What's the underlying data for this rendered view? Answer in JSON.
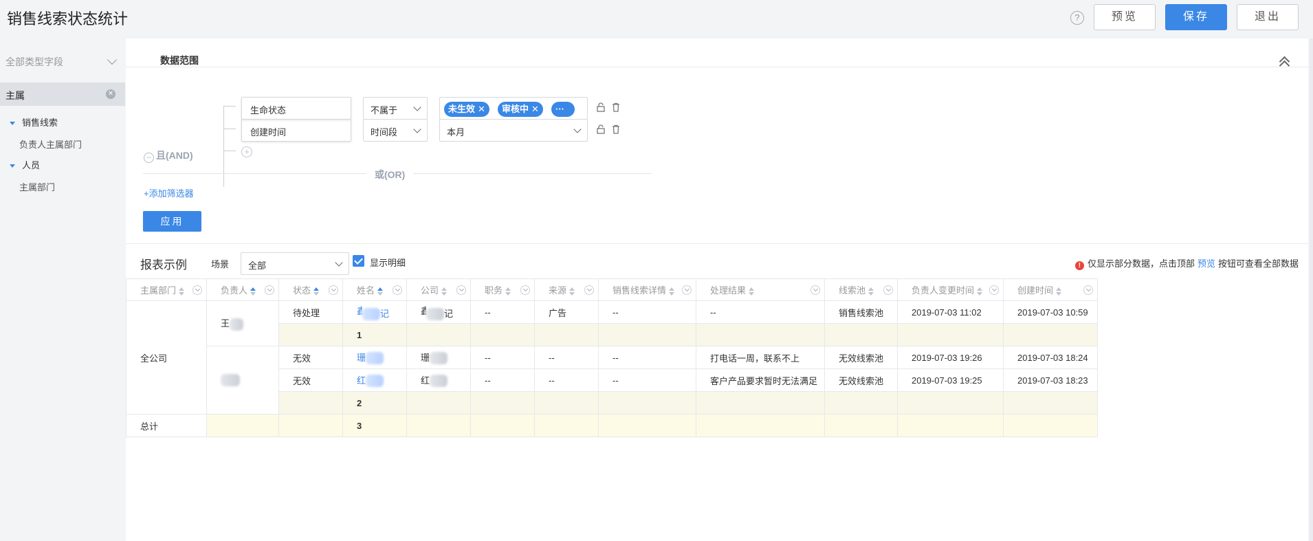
{
  "header": {
    "title": "销售线索状态统计",
    "help": "?",
    "preview_label": "预览",
    "save_label": "保存",
    "exit_label": "退出"
  },
  "sidebar": {
    "type_select": "全部类型字段",
    "active_item": "主属",
    "groups": [
      {
        "label": "销售线索",
        "items": [
          "负责人主属部门"
        ]
      },
      {
        "label": "人员",
        "items": [
          "主属部门"
        ]
      }
    ]
  },
  "filter": {
    "section_title": "数据范围",
    "and_label": "且(AND)",
    "conditions": [
      {
        "field": "生命状态",
        "operator": "不属于",
        "tags": [
          "未生效",
          "审核中",
          "···"
        ]
      },
      {
        "field": "创建时间",
        "operator": "时间段",
        "value": "本月"
      }
    ],
    "or_label": "或(OR)",
    "add_filter": "+添加筛选器",
    "apply_label": "应用"
  },
  "report": {
    "title": "报表示例",
    "scene_label": "场景",
    "scene_value": "全部",
    "show_detail_label": "显示明细",
    "show_detail_checked": true,
    "notice_prefix": "仅显示部分数据，点击顶部",
    "notice_link": "预览",
    "notice_suffix": "按钮可查看全部数据",
    "columns": [
      "主属部门",
      "负责人",
      "状态",
      "姓名",
      "公司",
      "职务",
      "来源",
      "销售线索详情",
      "处理结果",
      "线索池",
      "负责人变更时间",
      "创建时间"
    ],
    "dept": "全公司",
    "owner1": "王",
    "owner2": "",
    "rows": [
      {
        "status": "待处理",
        "name": "",
        "name_suffix": "记",
        "company": "",
        "company_suffix": "记",
        "title": "--",
        "source": "广告",
        "detail": "--",
        "result": "--",
        "pool": "销售线索池",
        "owner_changed": "2019-07-03 11:02",
        "created": "2019-07-03 10:59"
      },
      {
        "status": "无效",
        "name": "珊",
        "name_suffix": "",
        "company": "珊",
        "company_suffix": "",
        "title": "--",
        "source": "--",
        "detail": "--",
        "result": "打电话一周，联系不上",
        "pool": "无效线索池",
        "owner_changed": "2019-07-03 19:26",
        "created": "2019-07-03 18:24"
      },
      {
        "status": "无效",
        "name": "红",
        "name_suffix": "",
        "company": "红",
        "company_suffix": "",
        "title": "--",
        "source": "--",
        "detail": "--",
        "result": "客户产品要求暂时无法满足",
        "pool": "无效线索池",
        "owner_changed": "2019-07-03 19:25",
        "created": "2019-07-03 18:23"
      }
    ],
    "subtotal1": "1",
    "subtotal2": "2",
    "total_label": "总计",
    "total": "3"
  }
}
